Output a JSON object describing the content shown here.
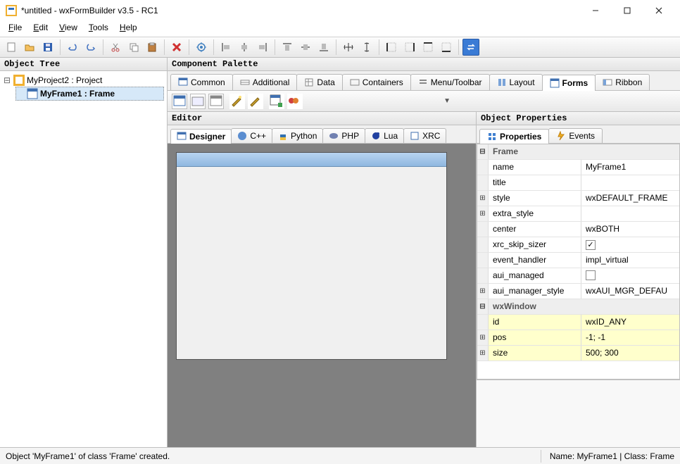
{
  "window": {
    "title": "*untitled - wxFormBuilder v3.5 - RC1"
  },
  "menubar": [
    {
      "label": "File",
      "accel": "F"
    },
    {
      "label": "Edit",
      "accel": "E"
    },
    {
      "label": "View",
      "accel": "V"
    },
    {
      "label": "Tools",
      "accel": "T"
    },
    {
      "label": "Help",
      "accel": "H"
    }
  ],
  "panes": {
    "object_tree": "Object Tree",
    "component_palette": "Component Palette",
    "editor": "Editor",
    "object_properties": "Object Properties"
  },
  "tree": {
    "project": "MyProject2 : Project",
    "frame": "MyFrame1 : Frame"
  },
  "palette_tabs": [
    "Common",
    "Additional",
    "Data",
    "Containers",
    "Menu/Toolbar",
    "Layout",
    "Forms",
    "Ribbon"
  ],
  "palette_active_index": 6,
  "editor_tabs": [
    "Designer",
    "C++",
    "Python",
    "PHP",
    "Lua",
    "XRC"
  ],
  "editor_active_index": 0,
  "props_tabs": [
    "Properties",
    "Events"
  ],
  "props_active_index": 0,
  "properties": {
    "categories": [
      {
        "name": "Frame",
        "rows": [
          {
            "exp": "",
            "name": "name",
            "value": "MyFrame1"
          },
          {
            "exp": "",
            "name": "title",
            "value": ""
          },
          {
            "exp": "+",
            "name": "style",
            "value": "wxDEFAULT_FRAME"
          },
          {
            "exp": "+",
            "name": "extra_style",
            "value": ""
          },
          {
            "exp": "",
            "name": "center",
            "value": "wxBOTH"
          },
          {
            "exp": "",
            "name": "xrc_skip_sizer",
            "type": "check",
            "checked": true
          },
          {
            "exp": "",
            "name": "event_handler",
            "value": "impl_virtual"
          },
          {
            "exp": "",
            "name": "aui_managed",
            "type": "check",
            "checked": false
          },
          {
            "exp": "+",
            "name": "aui_manager_style",
            "value": "wxAUI_MGR_DEFAU"
          }
        ]
      },
      {
        "name": "wxWindow",
        "rows": [
          {
            "exp": "",
            "name": "id",
            "value": "wxID_ANY",
            "hilite": true
          },
          {
            "exp": "+",
            "name": "pos",
            "value": "-1; -1",
            "hilite": true
          },
          {
            "exp": "+",
            "name": "size",
            "value": "500; 300",
            "hilite": true
          }
        ]
      }
    ]
  },
  "statusbar": {
    "left": "Object 'MyFrame1' of class 'Frame' created.",
    "right": "Name: MyFrame1 | Class: Frame"
  }
}
